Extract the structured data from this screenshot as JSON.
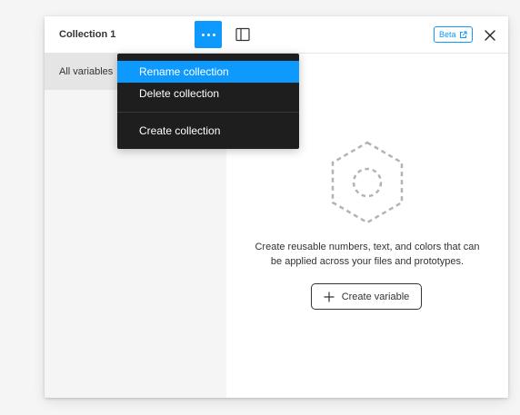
{
  "header": {
    "title": "Collection 1",
    "beta_label": "Beta"
  },
  "icons": {
    "more": "more-horizontal-icon",
    "panel": "sidebar-toggle-icon",
    "external": "external-link-icon",
    "close": "close-icon",
    "empty": "hexagon-variable-icon",
    "add": "plus-icon"
  },
  "sidebar": {
    "items": [
      {
        "label": "All variables",
        "selected": true
      }
    ]
  },
  "menu": {
    "items": [
      {
        "label": "Rename collection",
        "highlighted": true
      },
      {
        "label": "Delete collection",
        "highlighted": false
      },
      {
        "label": "Create collection",
        "highlighted": false
      }
    ]
  },
  "empty_state": {
    "line1": "Create reusable numbers, text, and colors that can",
    "line2": "be applied across your files and prototypes.",
    "button_label": "Create variable"
  },
  "colors": {
    "accent": "#0d99ff",
    "menu_bg": "#1e1e1e",
    "sidebar_bg": "#f5f5f5",
    "sidebar_selected_bg": "#e5e5e5"
  }
}
